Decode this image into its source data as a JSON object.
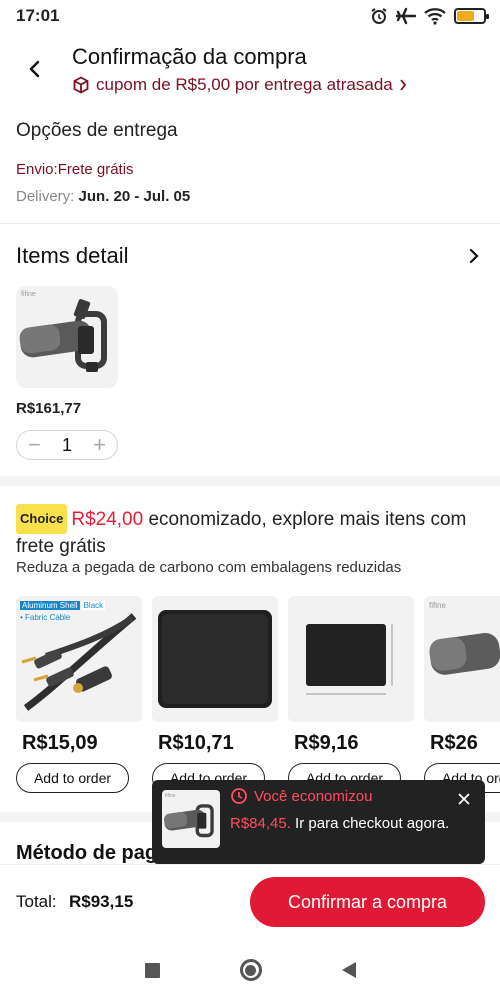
{
  "status_bar": {
    "time": "17:01",
    "battery_level": 0.65,
    "icons": [
      "alarm-icon",
      "airplane-mode-icon",
      "wifi-icon",
      "battery-icon"
    ]
  },
  "header": {
    "title": "Confirmação da compra",
    "coupon": "cupom de R$5,00 por entrega atrasada",
    "back_icon": "chevron-left-icon",
    "coupon_icon": "cube-icon"
  },
  "delivery": {
    "title": "Opções de entrega",
    "shipping": "Envio:Frete grátis",
    "dates_label": "Delivery:",
    "dates_value": "Jun. 20 - Jul. 05"
  },
  "items": {
    "title": "Items detail",
    "product": {
      "brand": "fifine",
      "price": "R$161,77",
      "quantity": "1"
    }
  },
  "choice": {
    "badge": "Choice",
    "saved_amount": "R$24,00",
    "headline_rest": " economizado, explore mais itens com frete grátis",
    "subtitle": "Reduza a pegada de carbono com embalagens reduzidas",
    "products": [
      {
        "price": "R$15,09",
        "add_label": "Add to order",
        "tag_line1": "Aluminum Shell",
        "tag_color": "Black",
        "tag_line2": "• Fabric Cable"
      },
      {
        "price": "R$10,71",
        "add_label": "Add to order"
      },
      {
        "price": "R$9,16",
        "add_label": "Add to order"
      },
      {
        "price": "R$26",
        "add_label": "Add to order",
        "brand": "fifine"
      }
    ]
  },
  "payment": {
    "title": "Método de pagamento"
  },
  "toast": {
    "title": "Você economizou",
    "amount": "R$84,45.",
    "message": " Ir para checkout agora.",
    "brand": "fifine"
  },
  "footer": {
    "total_label": "Total:",
    "total_value": "R$93,15",
    "confirm_label": "Confirmar a compra"
  },
  "colors": {
    "accent": "#e01a35",
    "coupon": "#7a0f25",
    "choice_badge": "#f9e14b",
    "toast_bg": "#222222"
  }
}
